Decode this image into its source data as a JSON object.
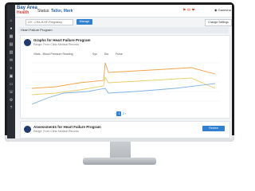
{
  "header": {
    "logo_line1": "Bay Area",
    "logo_line2": "Health",
    "status_prefix": "Status:",
    "status_name": "Tallor, Mark",
    "alert_icons": "⚑ ✉ ❤",
    "user_label": "Ganesha"
  },
  "toolbar": {
    "select_value": "CH - CHA-H-HF-Pregnancy",
    "add_button": "Manage",
    "settings_button": "Change Settings"
  },
  "panel": {
    "title": "Heart Failure Program"
  },
  "card": {
    "title": "Graphs for Heart Failure Program",
    "subtitle": "Range: From Clinic Medical Records",
    "chart_label": "Vitals - Blood Pressure Reading",
    "legend": [
      "Sys",
      "Dia",
      "Pulse"
    ]
  },
  "pagination": {
    "prev": "‹",
    "page1": "1",
    "page2": "2",
    "next": "›"
  },
  "card2": {
    "title": "Assessments for Heart Failure Program",
    "subtitle": "Range: From Clinic Medical Records",
    "button": "Review"
  },
  "colors": {
    "accent": "#2f80d1",
    "brand": "#1e4f8f",
    "series_orange": "#f0a44a",
    "series_yellow": "#e9cf6a",
    "series_blue": "#7fb2e5"
  }
}
